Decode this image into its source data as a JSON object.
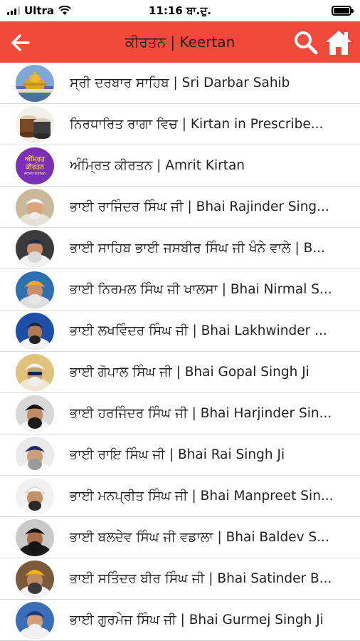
{
  "status_bar": {
    "carrier": "Ultra",
    "time": "11:16 ਬਾ.ਦੁ."
  },
  "header": {
    "title": "ਕੀਰਤਨ | Keertan",
    "accent_color": "#f04a3c"
  },
  "items": [
    {
      "label": "ਸ੍ਰੀ ਦਰਬਾਰ ਸਾਹਿਬ | Sri Darbar Sahib",
      "icon": "golden-temple-image"
    },
    {
      "label": "ਨਿਰਧਾਰਿਤ ਰਾਗਾ ਵਿਚ | Kirtan in Prescribe...",
      "icon": "tabla-image"
    },
    {
      "label": "ਅੰਮ੍ਰਿਤ ਕੀਰਤਨ | Amrit Kirtan",
      "icon": "amrit-kirtan-logo",
      "logo_text": [
        "ਅੰਮ੍ਰਿਤ",
        "ਕੀਰਤਨ",
        "Amrit Kirtan"
      ]
    },
    {
      "label": "ਭਾਈ ਰਾਜਿੰਦਰ ਸਿੰਘ ਜੀ | Bhai Rajinder Sing...",
      "icon": "singer-portrait"
    },
    {
      "label": "ਭਾਈ ਸਾਹਿਬ ਭਾਈ ਜਸਬੀਰ ਸਿੰਘ ਜੀ ਖੰਨੇ ਵਾਲੇ | B...",
      "icon": "singer-portrait"
    },
    {
      "label": "ਭਾਈ ਨਿਰਮਲ ਸਿੰਘ ਜੀ ਖਾਲਸਾ | Bhai Nirmal S...",
      "icon": "singer-portrait"
    },
    {
      "label": "ਭਾਈ ਲਖਵਿੰਦਰ ਸਿੰਘ ਜੀ | Bhai Lakhwinder ...",
      "icon": "singer-portrait"
    },
    {
      "label": "ਭਾਈ ਗੋਪਾਲ ਸਿੰਘ ਜੀ | Bhai Gopal Singh Ji",
      "icon": "singer-portrait"
    },
    {
      "label": "ਭਾਈ ਹਰਜਿੰਦਰ ਸਿੰਘ ਜੀ | Bhai Harjinder Sin...",
      "icon": "singer-portrait"
    },
    {
      "label": "ਭਾਈ ਰਾਇ ਸਿੰਘ ਜੀ | Bhai Rai Singh Ji",
      "icon": "singer-portrait"
    },
    {
      "label": "ਭਾਈ ਮਨਪ੍ਰੀਤ ਸਿੰਘ ਜੀ | Bhai Manpreet Sin...",
      "icon": "singer-portrait"
    },
    {
      "label": "ਭਾਈ ਬਲਦੇਵ ਸਿੰਘ ਜੀ ਵਡਾਲਾ | Bhai Baldev S...",
      "icon": "singer-portrait"
    },
    {
      "label": "ਭਾਈ ਸਤਿੰਦਰ ਬੀਰ ਸਿੰਘ ਜੀ | Bhai Satinder B...",
      "icon": "singer-portrait"
    },
    {
      "label": "ਭਾਈ ਗੁਰਮੇਜ ਸਿੰਘ ਜੀ | Bhai Gurmej Singh Ji",
      "icon": "singer-portrait"
    }
  ]
}
